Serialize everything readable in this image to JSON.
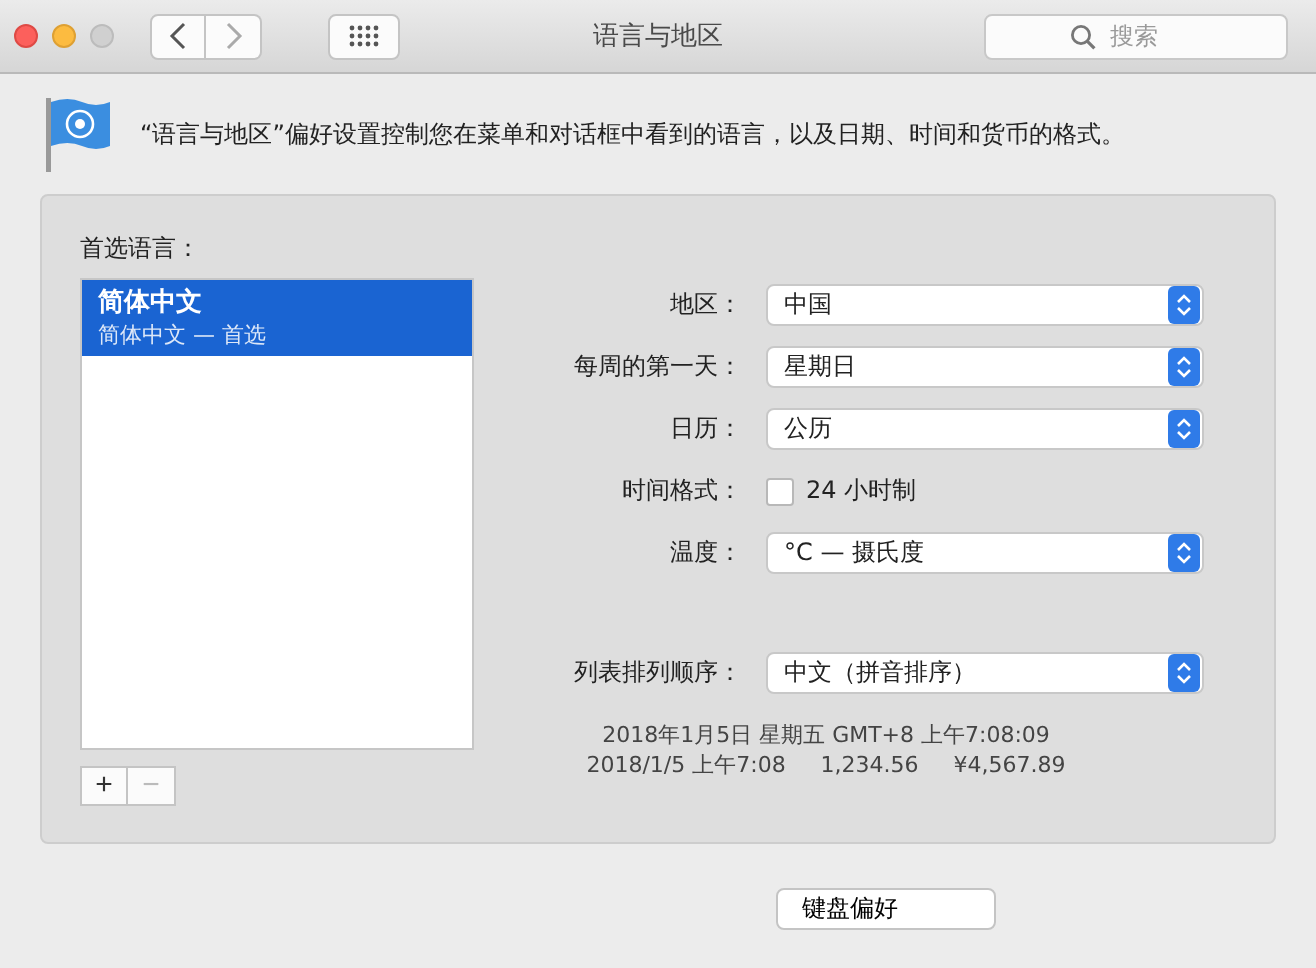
{
  "window": {
    "title": "语言与地区",
    "search": {
      "placeholder": "搜索"
    }
  },
  "description": "“语言与地区”偏好设置控制您在菜单和对话框中看到的语言，以及日期、时间和货币的格式。",
  "languages": {
    "label": "首选语言：",
    "items": [
      {
        "name": "简体中文",
        "detail": "简体中文 — 首选",
        "selected": true
      }
    ],
    "add_button": "+",
    "remove_button": "−"
  },
  "settings": [
    {
      "kind": "popup",
      "label": "地区：",
      "value": "中国"
    },
    {
      "kind": "popup",
      "label": "每周的第一天：",
      "value": "星期日"
    },
    {
      "kind": "popup",
      "label": "日历：",
      "value": "公历"
    },
    {
      "kind": "checkbox",
      "label": "时间格式：",
      "value": "24 小时制",
      "checked": false
    },
    {
      "kind": "popup",
      "label": "温度：",
      "value": "°C — 摄氏度"
    },
    {
      "kind": "gap"
    },
    {
      "kind": "popup",
      "label": "列表排列顺序：",
      "value": "中文（拼音排序）"
    }
  ],
  "samples": [
    "2018年1月5日 星期五 GMT+8 上午7:08:09",
    "2018/1/5 上午7:08     1,234.56     ¥4,567.89"
  ],
  "footer_button": "键盘偏好"
}
